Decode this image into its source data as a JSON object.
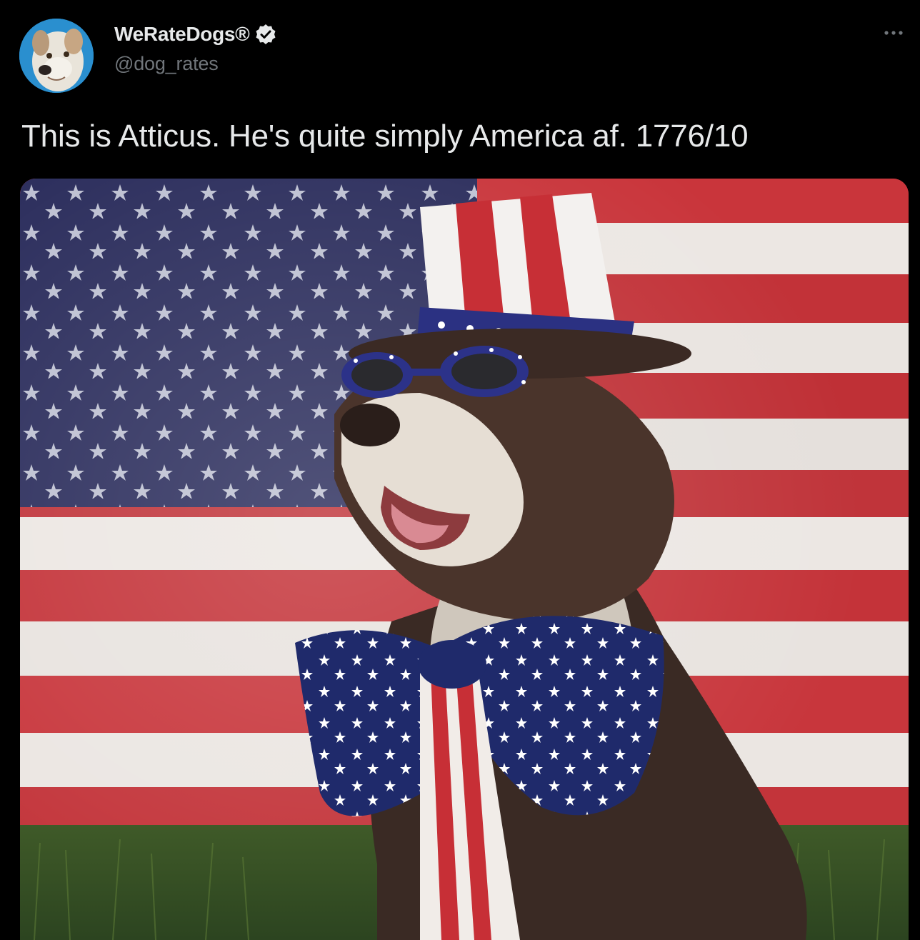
{
  "tweet": {
    "author": {
      "display_name": "WeRateDogs®",
      "handle": "@dog_rates",
      "verified": true,
      "avatar_icon": "dog-avatar-icon",
      "verified_icon": "verified-badge-icon"
    },
    "more_icon": "more-options-icon",
    "text": "This is Atticus. He's quite simply America af. 1776/10",
    "media": {
      "type": "photo"
    }
  },
  "colors": {
    "background": "#000000",
    "primary_text": "#e7e9ea",
    "secondary_text": "#71767b",
    "accent": "#1d9bf0"
  }
}
